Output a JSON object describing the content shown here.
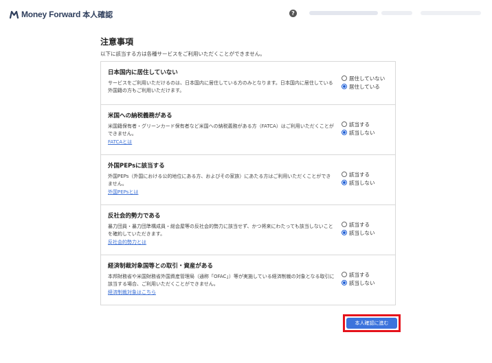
{
  "header": {
    "brand": "Money Forward",
    "suffix": "本人確認",
    "help_icon": "question-circle-icon",
    "help_glyph": "?"
  },
  "main": {
    "title": "注意事項",
    "subtitle": "以下に該当する方は各種サービスをご利用いただくことができません。",
    "items": [
      {
        "title": "日本国内に居住していない",
        "description": "サービスをご利用いただけるのは、日本国内に居住している方のみとなります。日本国内に居住している外国籍の方もご利用いただけます。",
        "link": "",
        "options": [
          "居住していない",
          "居住している"
        ],
        "selected": 1
      },
      {
        "title": "米国への納税義務がある",
        "description": "米国籍保有者・グリーンカード保有者など米国への納税義務がある方（FATCA）はご利用いただくことができません。",
        "link": "FATCAとは",
        "options": [
          "該当する",
          "該当しない"
        ],
        "selected": 1
      },
      {
        "title": "外国PEPsに該当する",
        "description": "外国PEPs（外国における公的地位にある方、およびその家族）にあたる方はご利用いただくことができません。",
        "link": "外国PEPsとは",
        "options": [
          "該当する",
          "該当しない"
        ],
        "selected": 1
      },
      {
        "title": "反社会的勢力である",
        "description": "暴力団員・暴力団準構成員・総会屋等の反社会的勢力に該当せず、かつ将来にわたっても該当しないことを確約していただきます。",
        "link": "反社会的勢力とは",
        "options": [
          "該当する",
          "該当しない"
        ],
        "selected": 1
      },
      {
        "title": "経済制裁対象国等との取引・資産がある",
        "description": "本邦財務省や米国財務省外国資産管理局（通称「OFAC」）等が実施している経済制裁の対象となる取引に該当する場合、ご利用いただくことができません。",
        "link": "経済制裁対象はこちら",
        "options": [
          "該当する",
          "該当しない"
        ],
        "selected": 1
      }
    ]
  },
  "cta": {
    "label": "本人確認に進む",
    "highlight_color": "#e5121b",
    "button_color": "#3c73dc"
  },
  "colors": {
    "accent": "#1f5fd6",
    "link": "#3b6fd4"
  }
}
